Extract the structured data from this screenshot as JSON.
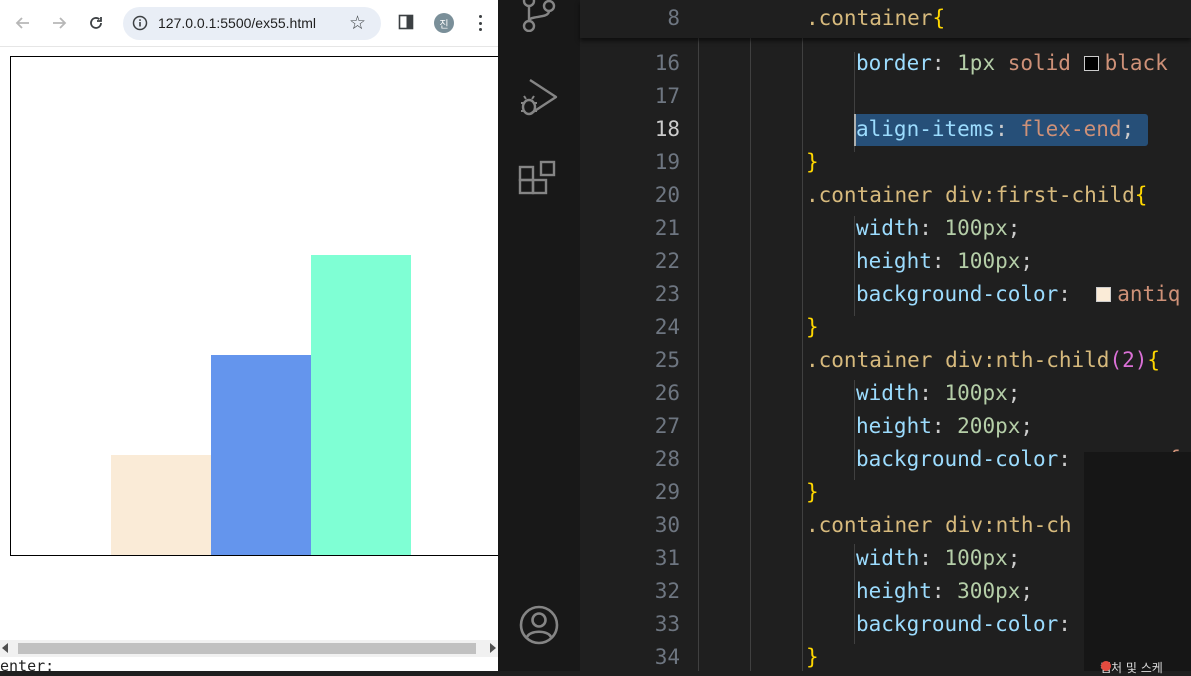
{
  "browser": {
    "url": "127.0.0.1:5500/ex55.html",
    "profile_initial": "진",
    "console_text": "enter:"
  },
  "editor": {
    "sticky_line": {
      "number": "8",
      "selector": ".container",
      "brace": "{"
    },
    "lines": [
      {
        "n": "16",
        "prop": "border",
        "rest": ": 1px solid ",
        "swatch": "#000000",
        "value": "black"
      },
      {
        "n": "17"
      },
      {
        "n": "18",
        "prop": "align-items",
        "rest": ": ",
        "value": "flex-end",
        "end": ";"
      },
      {
        "n": "19",
        "brace": "}"
      },
      {
        "n": "20",
        "selector": ".container div:first-child",
        "brace": "{"
      },
      {
        "n": "21",
        "prop": "width",
        "num": "100px"
      },
      {
        "n": "22",
        "prop": "height",
        "num": "100px"
      },
      {
        "n": "23",
        "prop": "background-color",
        "swatch": "#faebd7",
        "value": "antiq"
      },
      {
        "n": "24",
        "brace": "}"
      },
      {
        "n": "25",
        "selector": ".container div:nth-child",
        "paren": "(2)",
        "brace": "{"
      },
      {
        "n": "26",
        "prop": "width",
        "num": "100px"
      },
      {
        "n": "27",
        "prop": "height",
        "num": "200px"
      },
      {
        "n": "28",
        "prop": "background-color",
        "swatch": "#6495ed",
        "value": "cornf"
      },
      {
        "n": "29",
        "brace": "}"
      },
      {
        "n": "30",
        "selector": ".container div:nth-ch"
      },
      {
        "n": "31",
        "prop": "width",
        "num": "100px"
      },
      {
        "n": "32",
        "prop": "height",
        "num": "300px"
      },
      {
        "n": "33",
        "prop": "background-color",
        "rest": ":"
      },
      {
        "n": "34",
        "brace": "}"
      }
    ]
  },
  "overlay": {
    "label": "캡처 및 스케"
  },
  "colors": {
    "box1": "#faebd7",
    "box2": "#6495ed",
    "box3": "#7fffd4",
    "selection": "#264f78"
  }
}
